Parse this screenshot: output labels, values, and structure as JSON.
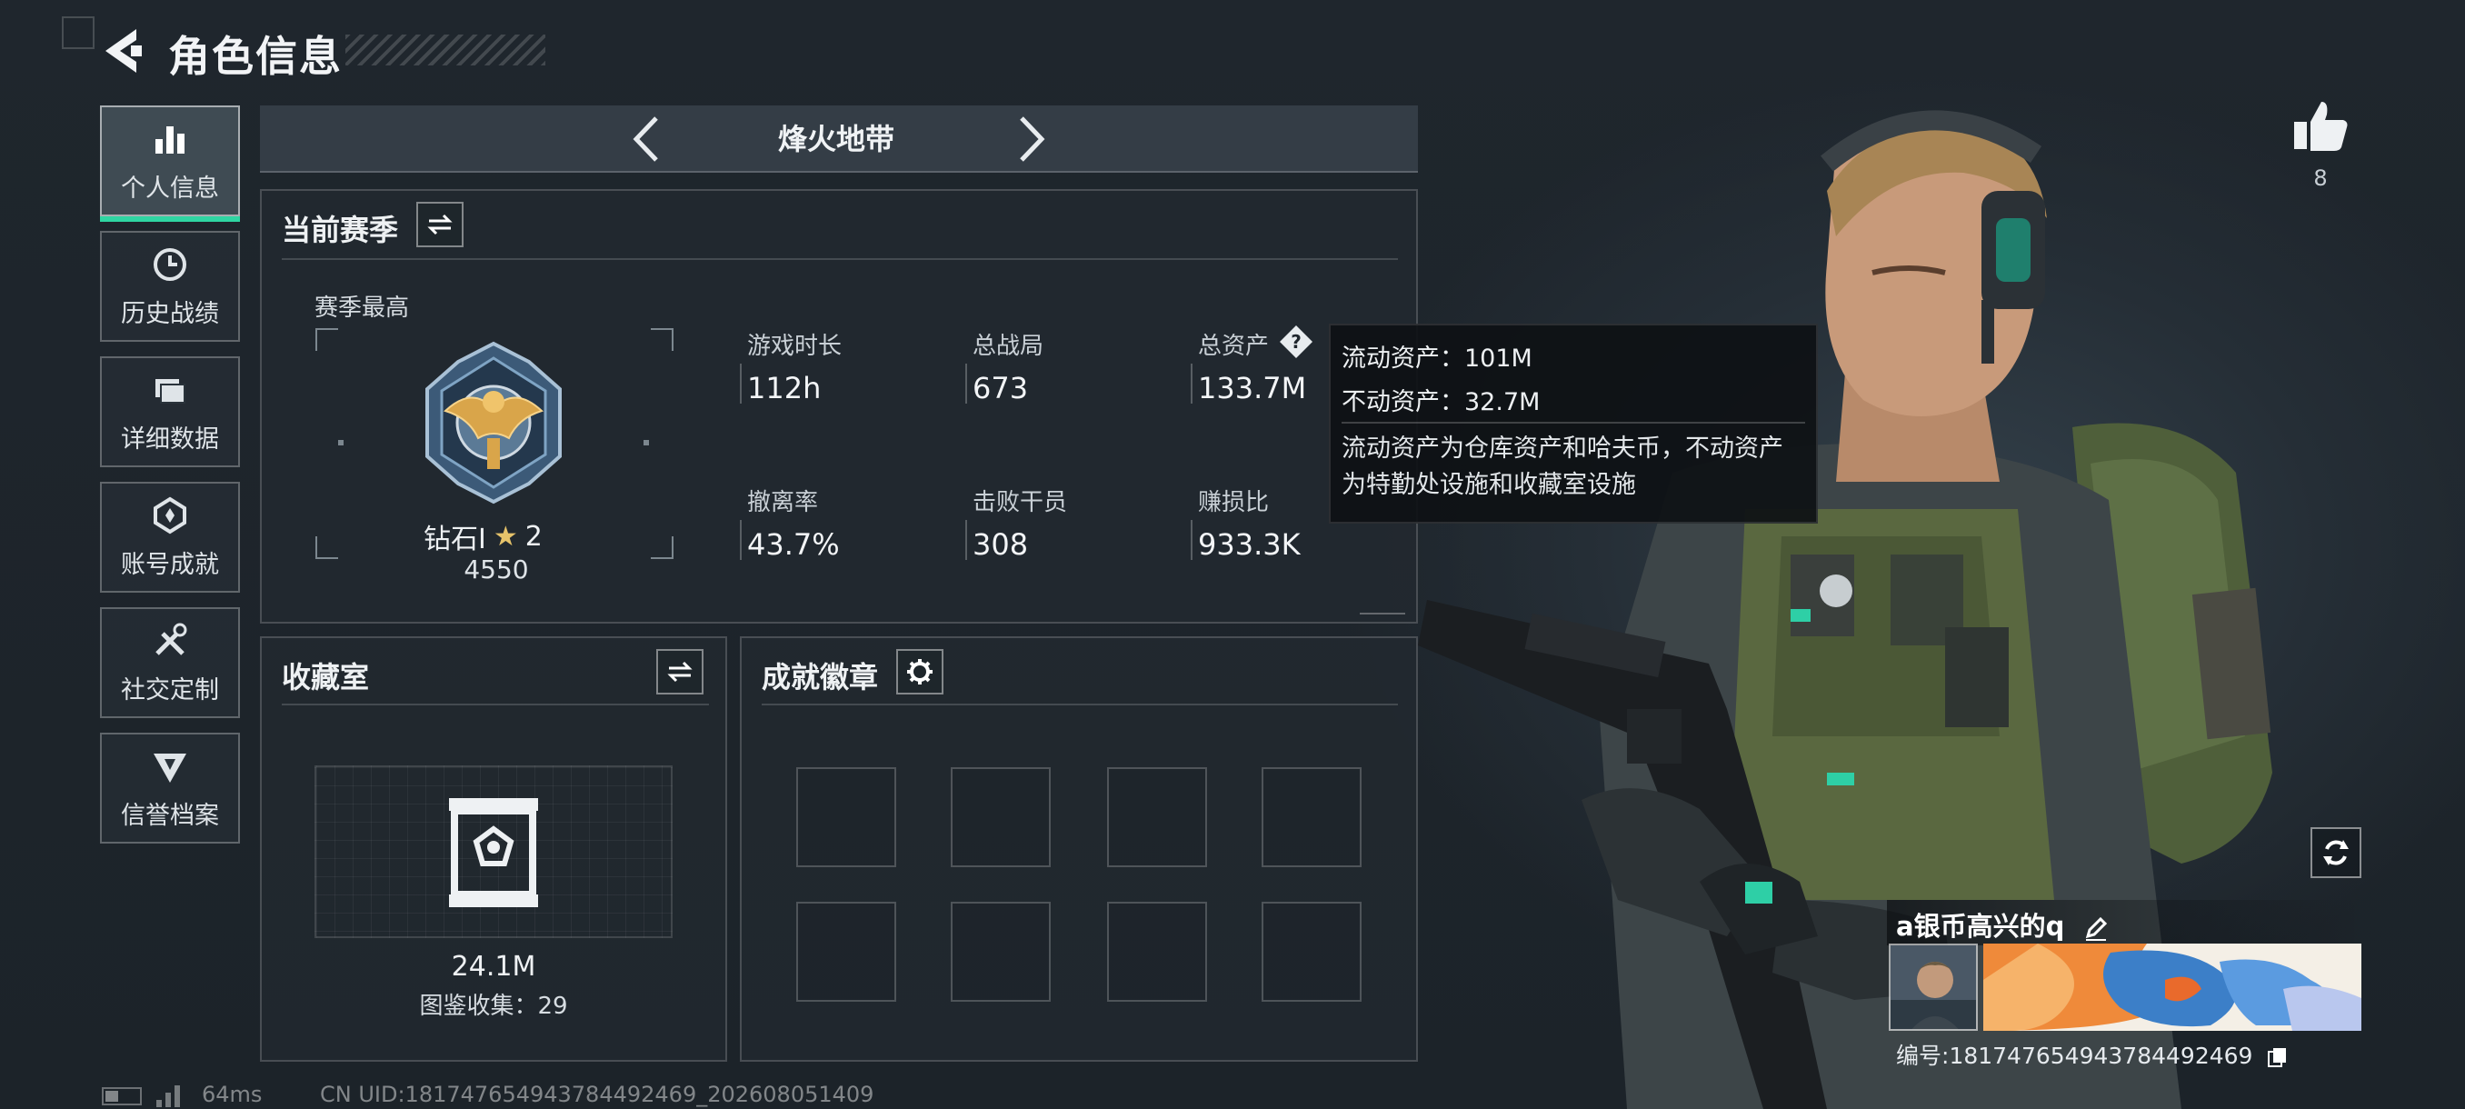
{
  "header": {
    "title": "角色信息"
  },
  "sidebar": {
    "items": [
      {
        "label": "个人信息",
        "icon": "bar-chart-icon",
        "active": true
      },
      {
        "label": "历史战绩",
        "icon": "clock-icon",
        "active": false
      },
      {
        "label": "详细数据",
        "icon": "folder-icon",
        "active": false
      },
      {
        "label": "账号成就",
        "icon": "medal-icon",
        "active": false
      },
      {
        "label": "社交定制",
        "icon": "tools-icon",
        "active": false
      },
      {
        "label": "信誉档案",
        "icon": "credit-badge-icon",
        "active": false
      }
    ]
  },
  "mode": {
    "title": "烽火地带"
  },
  "season": {
    "title": "当前赛季",
    "best_label": "赛季最高",
    "rank_name": "钻石Ⅰ",
    "stars": "2",
    "rank_points": "4550",
    "stats": [
      {
        "label": "游戏时长",
        "value": "112h"
      },
      {
        "label": "总战局",
        "value": "673"
      },
      {
        "label": "总资产",
        "value": "133.7M"
      },
      {
        "label": "撤离率",
        "value": "43.7%"
      },
      {
        "label": "击败干员",
        "value": "308"
      },
      {
        "label": "赚损比",
        "value": "933.3K"
      }
    ]
  },
  "tooltip": {
    "liquid_label": "流动资产：",
    "liquid_value": "101M",
    "fixed_label": "不动资产：",
    "fixed_value": "32.7M",
    "desc_line1": "流动资产为仓库资产和哈夫币，不动资产",
    "desc_line2": "为特勤处设施和收藏室设施"
  },
  "collection": {
    "title": "收藏室",
    "value": "24.1M",
    "collect_label": "图鉴收集：",
    "collect_count": "29"
  },
  "badges": {
    "title": "成就徽章"
  },
  "profile": {
    "likes": "8",
    "player_name": "a银币高兴的q",
    "id_label": "编号:",
    "id_value": "18174765494378449​2469"
  },
  "footer": {
    "ping": "64ms",
    "uid": "CN UID:18174765494378449​2469_202608051409"
  },
  "colors": {
    "accent": "#2fd6a3",
    "panel": "#222a31",
    "tooltip": "#0e1114"
  }
}
